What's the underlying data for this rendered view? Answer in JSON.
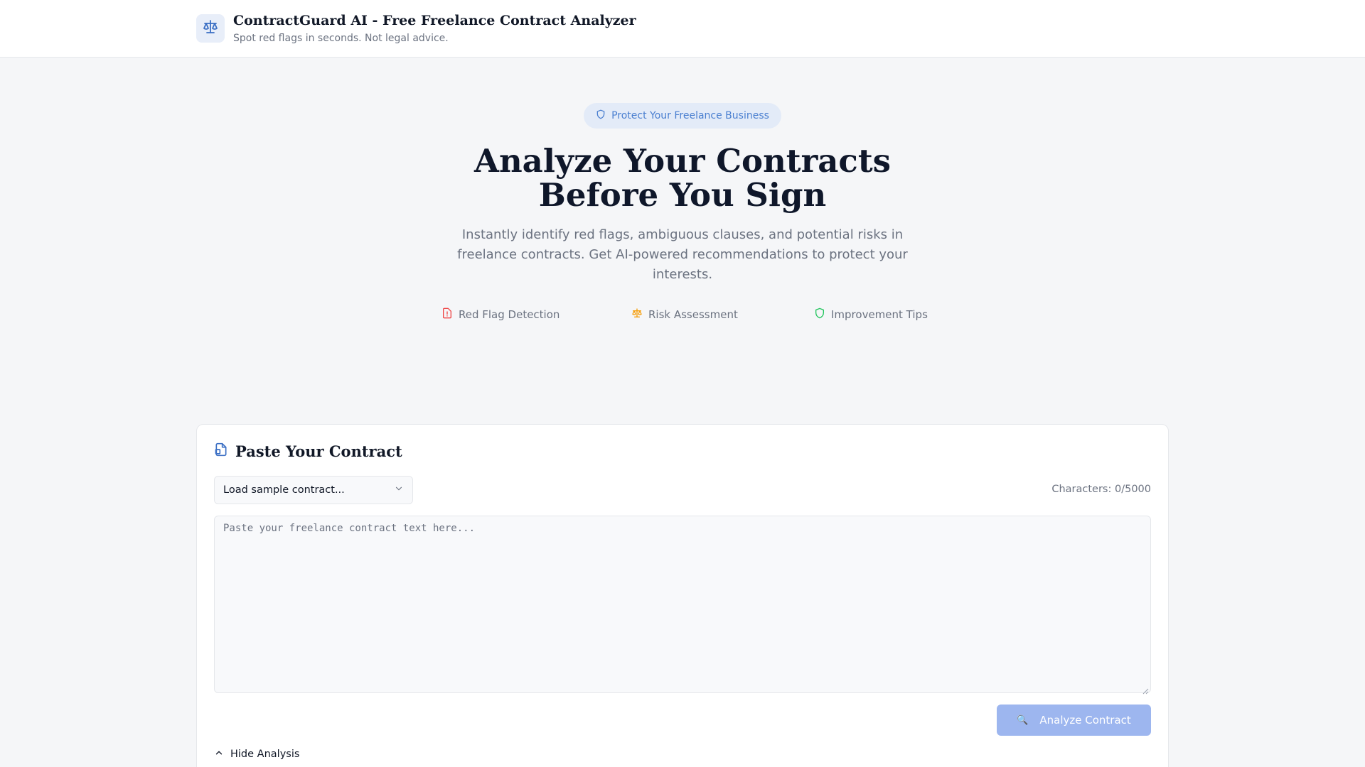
{
  "header": {
    "title": "ContractGuard AI - Free Freelance Contract Analyzer",
    "subtitle": "Spot red flags in seconds. Not legal advice.",
    "logo_icon": "scale-icon"
  },
  "hero": {
    "badge": "Protect Your Freelance Business",
    "title_line1": "Analyze Your Contracts",
    "title_line2": "Before You Sign",
    "description": "Instantly identify red flags, ambiguous clauses, and potential risks in freelance contracts. Get AI-powered recommendations to protect your interests.",
    "features": [
      {
        "label": "Red Flag Detection",
        "icon": "alert-file-icon",
        "color": "#ef4444"
      },
      {
        "label": "Risk Assessment",
        "icon": "scale-icon",
        "color": "#f59e0b"
      },
      {
        "label": "Improvement Tips",
        "icon": "shield-icon",
        "color": "#22c55e"
      }
    ]
  },
  "card": {
    "title": "Paste Your Contract",
    "select_value": "Load sample contract...",
    "char_count": "Characters: 0/5000",
    "textarea_placeholder": "Paste your freelance contract text here...",
    "textarea_value": "",
    "analyze_label": "Analyze Contract",
    "analyze_icon": "🔍",
    "hide_label": "Hide Analysis"
  },
  "colors": {
    "accent": "#4a7fd0",
    "button_disabled": "#9db6ef",
    "page_bg": "#f5f6f8"
  }
}
